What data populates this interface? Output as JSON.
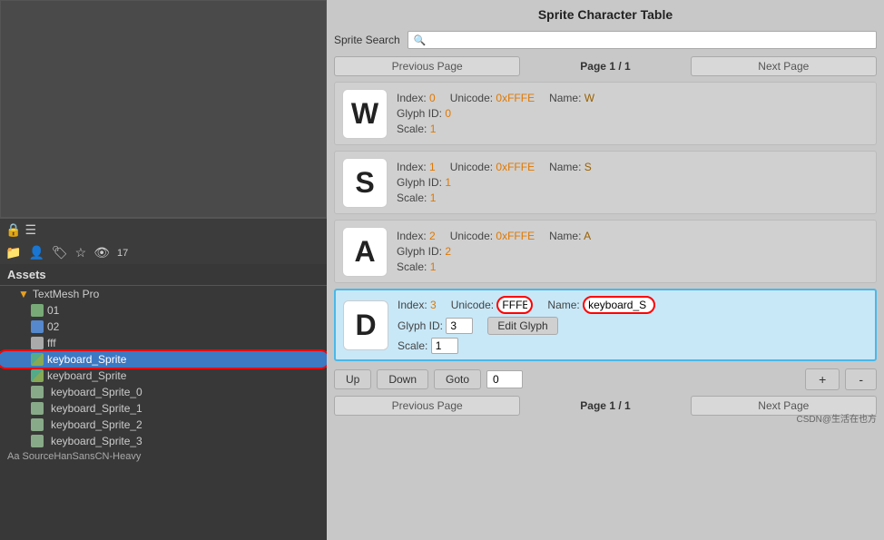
{
  "app": {
    "title": "Sprite Character Table"
  },
  "left_panel": {
    "assets_label": "Assets",
    "items": [
      {
        "id": "textmesh-pro",
        "label": "TextMesh Pro",
        "type": "folder",
        "indent": 1
      },
      {
        "id": "01",
        "label": "01",
        "type": "asset-green",
        "indent": 2
      },
      {
        "id": "02",
        "label": "02",
        "type": "asset-blue",
        "indent": 2
      },
      {
        "id": "fff",
        "label": "fff",
        "type": "asset-gray",
        "indent": 2
      },
      {
        "id": "keyboard-sprite",
        "label": "keyboard_Sprite",
        "type": "asset-img",
        "indent": 2,
        "selected": true
      },
      {
        "id": "keyboard-sprite2",
        "label": "keyboard_Sprite",
        "type": "asset-img",
        "indent": 2
      },
      {
        "id": "keyboard-sprite-0",
        "label": "keyboard_Sprite_0",
        "type": "asset-sub",
        "indent": 3
      },
      {
        "id": "keyboard-sprite-1",
        "label": "keyboard_Sprite_1",
        "type": "asset-sub",
        "indent": 3
      },
      {
        "id": "keyboard-sprite-2",
        "label": "keyboard_Sprite_2",
        "type": "asset-sub",
        "indent": 3
      },
      {
        "id": "keyboard-sprite-3",
        "label": "keyboard_Sprite_3",
        "type": "asset-sub",
        "indent": 3
      }
    ],
    "source_han": "Aa SourceHanSansCN-Heavy",
    "badge_count": "17"
  },
  "right_panel": {
    "title": "Sprite Character Table",
    "search_label": "Sprite Search",
    "search_placeholder": "🔍",
    "prev_page_label": "Previous Page",
    "page_label": "Page 1 / 1",
    "next_page_label": "Next Page",
    "glyphs": [
      {
        "char": "W",
        "index_label": "Index:",
        "index_val": "0",
        "unicode_label": "Unicode:",
        "unicode_val": "0xFFFE",
        "name_label": "Name:",
        "name_val": "W",
        "glyph_id_label": "Glyph ID:",
        "glyph_id_val": "0",
        "scale_label": "Scale:",
        "scale_val": "1",
        "highlighted": false
      },
      {
        "char": "S",
        "index_label": "Index:",
        "index_val": "1",
        "unicode_label": "Unicode:",
        "unicode_val": "0xFFFE",
        "name_label": "Name:",
        "name_val": "S",
        "glyph_id_label": "Glyph ID:",
        "glyph_id_val": "1",
        "scale_label": "Scale:",
        "scale_val": "1",
        "highlighted": false
      },
      {
        "char": "A",
        "index_label": "Index:",
        "index_val": "2",
        "unicode_label": "Unicode:",
        "unicode_val": "0xFFFE",
        "name_label": "Name:",
        "name_val": "A",
        "glyph_id_label": "Glyph ID:",
        "glyph_id_val": "2",
        "scale_label": "Scale:",
        "scale_val": "1",
        "highlighted": false
      },
      {
        "char": "D",
        "index_label": "Index:",
        "index_val": "3",
        "unicode_label": "Unicode:",
        "unicode_val": "FFFE",
        "name_label": "Name:",
        "name_val": "keyboard_S",
        "glyph_id_label": "Glyph ID:",
        "glyph_id_val": "3",
        "edit_glyph_label": "Edit Glyph",
        "scale_label": "Scale:",
        "scale_val": "1",
        "highlighted": true
      }
    ],
    "controls": {
      "up_label": "Up",
      "down_label": "Down",
      "goto_label": "Goto",
      "goto_val": "0",
      "plus_label": "+",
      "minus_label": "-"
    },
    "bottom_nav": {
      "prev_label": "Previous Page",
      "page_label": "Page 1 / 1",
      "next_label": "Next Page"
    }
  }
}
